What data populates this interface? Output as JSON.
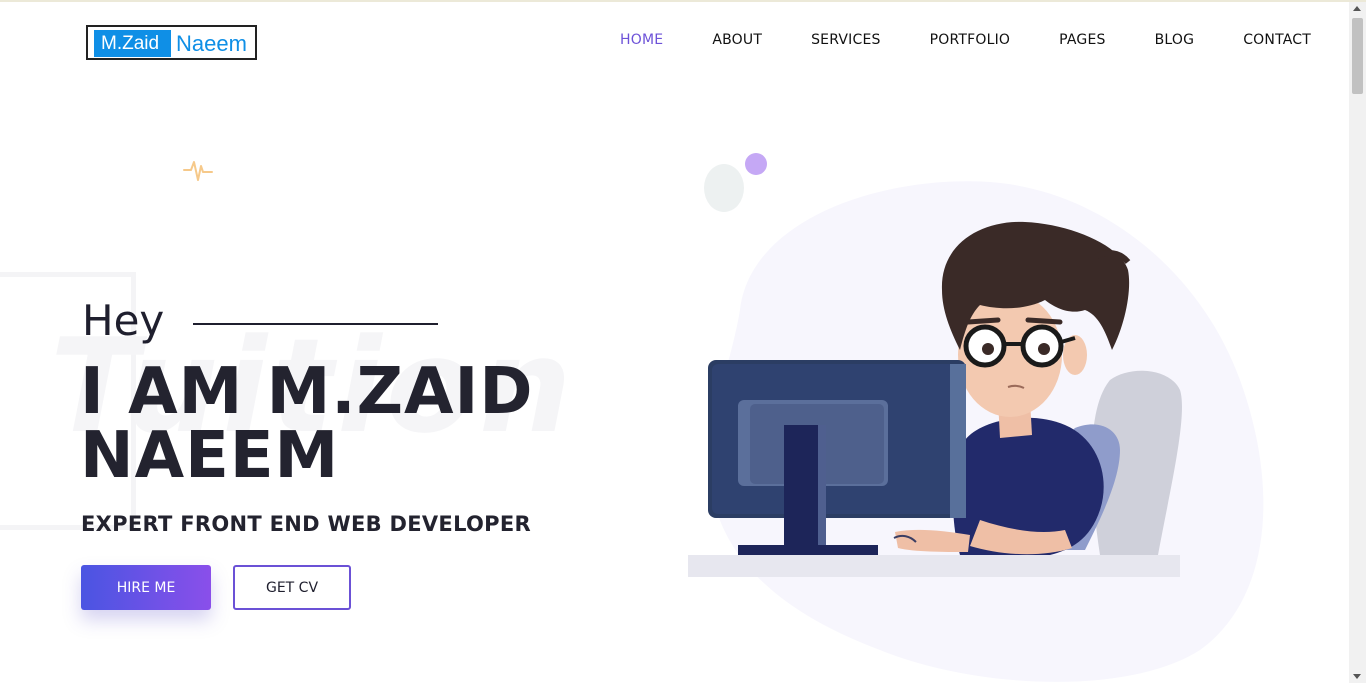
{
  "header": {
    "logo": {
      "part1": "M.Zaid",
      "part2": "Naeem"
    },
    "nav": [
      {
        "label": "HOME",
        "active": true
      },
      {
        "label": "ABOUT",
        "active": false
      },
      {
        "label": "SERVICES",
        "active": false
      },
      {
        "label": "PORTFOLIO",
        "active": false
      },
      {
        "label": "PAGES",
        "active": false
      },
      {
        "label": "BLOG",
        "active": false
      },
      {
        "label": "CONTACT",
        "active": false
      }
    ]
  },
  "hero": {
    "greeting": "Hey",
    "name_line1": "I AM M.ZAID",
    "name_line2": "NAEEM",
    "subtitle": "EXPERT FRONT END WEB DEVELOPER",
    "watermark": "Tuition",
    "buttons": {
      "primary": "HIRE ME",
      "secondary": "GET CV"
    }
  },
  "icons": {
    "pulse": "pulse-icon",
    "illustration": "developer-at-computer-illustration"
  },
  "colors": {
    "accent": "#6d52d8",
    "logo_blue": "#0f8fe6",
    "button_gradient_start": "#4a55e2",
    "button_gradient_end": "#8a4fea"
  }
}
